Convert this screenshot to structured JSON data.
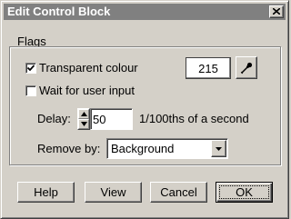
{
  "window": {
    "title": "Edit Control Block"
  },
  "flags": {
    "group_label": "Flags",
    "transparent_colour": {
      "label": "Transparent colour",
      "checked": true
    },
    "wait_for_input": {
      "label": "Wait for user input",
      "checked": false
    },
    "colour_value": "215",
    "delay_label": "Delay:",
    "delay_value": "50",
    "delay_unit": "1/100ths of a second",
    "remove_by_label": "Remove by:",
    "remove_by_value": "Background"
  },
  "buttons": {
    "help": "Help",
    "view": "View",
    "cancel": "Cancel",
    "ok": "OK"
  },
  "icons": {
    "close": "close-icon",
    "picker": "eyedropper-icon",
    "check": "checkmark-icon",
    "spin_up": "triangle-up-icon",
    "spin_down": "triangle-down-icon",
    "dropdown": "triangle-down-icon"
  }
}
